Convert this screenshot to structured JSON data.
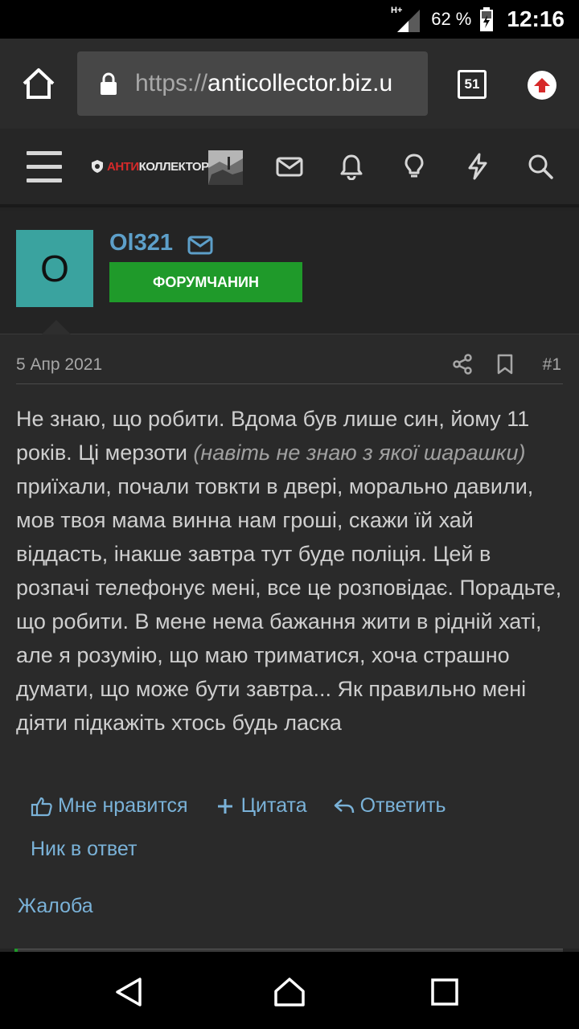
{
  "status_bar": {
    "network": "H+",
    "battery": "62 %",
    "clock": "12:16"
  },
  "browser": {
    "url_scheme": "https://",
    "url_host": "anticollector.biz.u",
    "tab_count": "51"
  },
  "site_nav": {
    "logo_prefix": "АНТИ",
    "logo_suffix": "КОЛЛЕКТОР",
    "icons": [
      "menu-icon",
      "mail-icon",
      "bell-icon",
      "lightbulb-icon",
      "lightning-icon",
      "search-icon"
    ]
  },
  "post": {
    "author": {
      "avatar_letter": "O",
      "name": "Ol321",
      "badge": "ФОРУМЧАНИН"
    },
    "date": "5 Апр 2021",
    "number": "#1",
    "text_1": "Не знаю, що робити. Вдома був лише син, йому 11 років. Ці мерзоти ",
    "text_italic": "(навіть не знаю з якої шарашки)",
    "text_2": " приїхали, почали товкти в двері, морально давили, мов твоя мама винна нам гроші, скажи їй хай віддасть, інакше завтра тут буде поліція. Цей в розпачі телефонує мені, все це розповідає. Порадьте, що робити. В мене нема бажання жити в рідній хаті, але я розумію, що маю триматися, хоча страшно думати, що може бути завтра... Як правильно мені діяти підкажіть хтось будь ласка",
    "actions": {
      "like": "Мне нравится",
      "quote": "Цитата",
      "reply": "Ответить",
      "nick_reply": "Ник в ответ",
      "complaint": "Жалоба"
    }
  },
  "colors": {
    "accent_link": "#7ab2d8",
    "username": "#5d9fc9",
    "badge_green": "#1f9a2a",
    "avatar_teal": "#3aa39f",
    "logo_red": "#d62a2a"
  }
}
